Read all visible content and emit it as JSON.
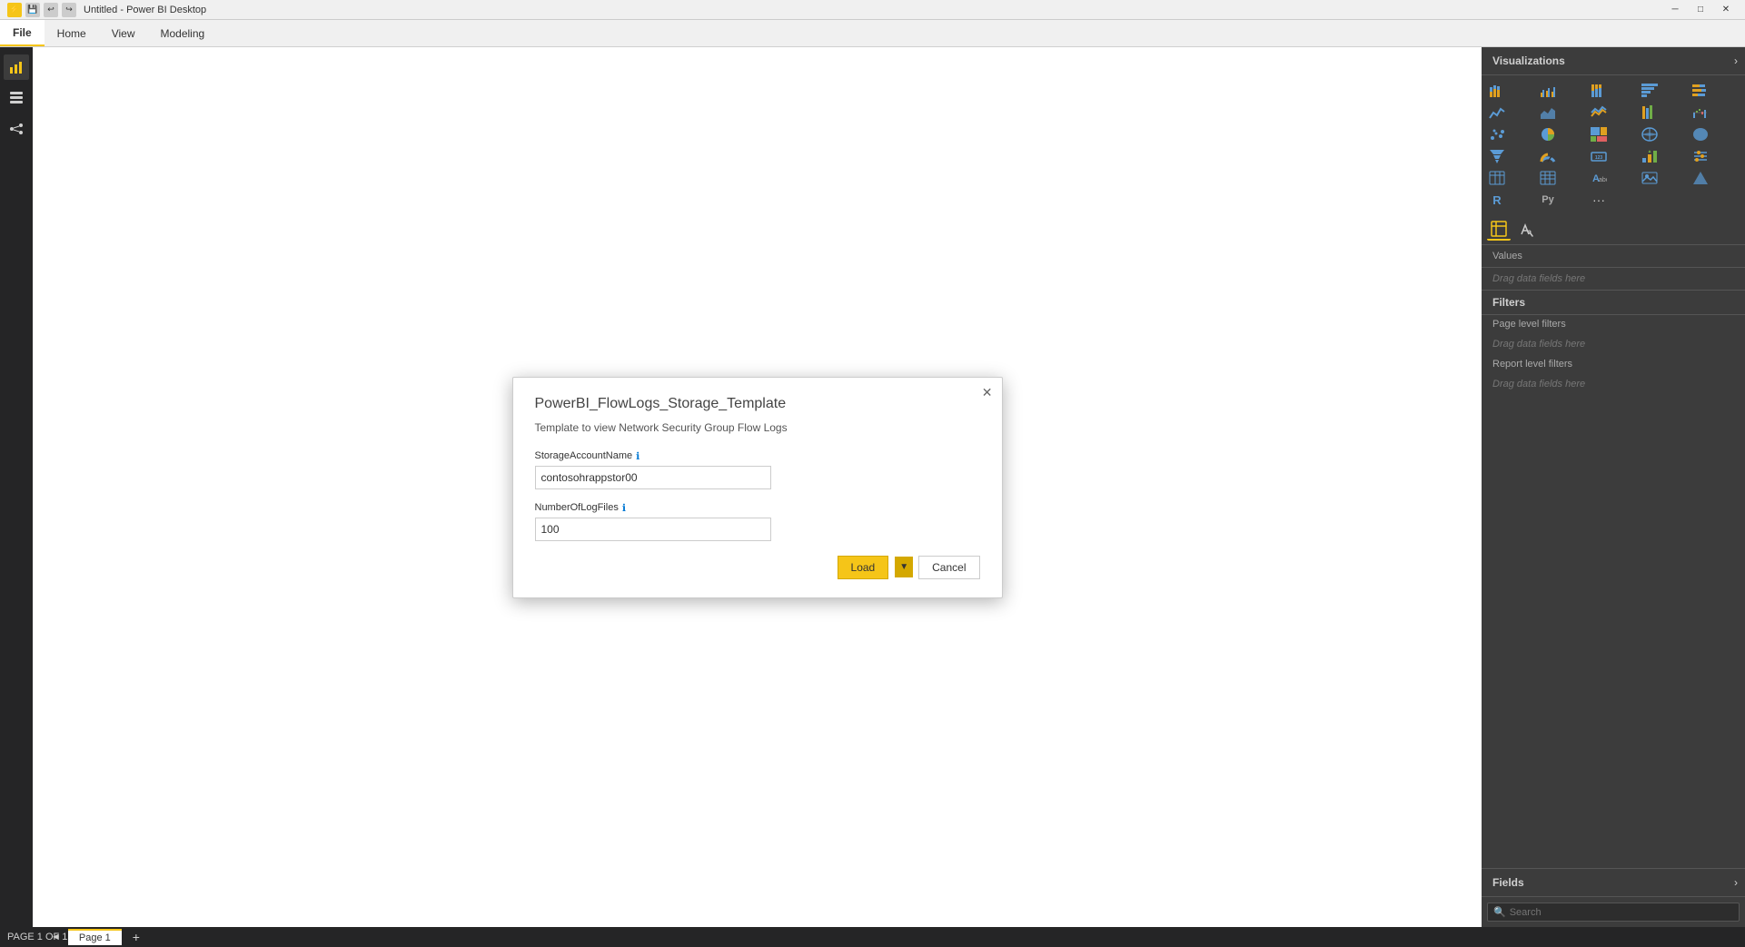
{
  "titleBar": {
    "title": "Untitled - Power BI Desktop",
    "icons": [
      "💾",
      "↩",
      "↪"
    ],
    "controls": [
      "─",
      "□",
      "✕"
    ]
  },
  "ribbon": {
    "tabs": [
      {
        "label": "File",
        "active": true
      },
      {
        "label": "Home",
        "active": false
      },
      {
        "label": "View",
        "active": false
      },
      {
        "label": "Modeling",
        "active": false
      }
    ]
  },
  "sidebar": {
    "icons": [
      "📊",
      "⊞",
      "🔗"
    ]
  },
  "visualizations": {
    "title": "Visualizations",
    "vizIcons": [
      "bar",
      "line",
      "area",
      "stacked-bar",
      "clustered-bar",
      "scatter",
      "pie",
      "treemap",
      "map",
      "filled-map",
      "table",
      "matrix",
      "card",
      "kpi",
      "slicer",
      "shape",
      "image",
      "text",
      "r",
      "py",
      "more"
    ],
    "toolbarTabs": [
      {
        "label": "⊞",
        "name": "fields-tab",
        "active": false
      },
      {
        "label": "🖌",
        "name": "format-tab",
        "active": false
      }
    ],
    "valuesLabel": "Values",
    "valuesDragHint": "Drag data fields here",
    "filtersLabel": "Filters",
    "pageLevelFilters": "Page level filters",
    "pageLevelDragHint": "Drag data fields here",
    "reportLevelFilters": "Report level filters",
    "reportLevelDragHint": "Drag data fields here"
  },
  "fields": {
    "title": "Fields",
    "search": {
      "placeholder": "Search",
      "value": ""
    }
  },
  "dialog": {
    "title": "PowerBI_FlowLogs_Storage_Template",
    "subtitle": "Template to view Network Security Group Flow Logs",
    "fields": [
      {
        "label": "StorageAccountName",
        "hasInfo": true,
        "value": "contosohrappstor00",
        "placeholder": ""
      },
      {
        "label": "NumberOfLogFiles",
        "hasInfo": true,
        "value": "100",
        "placeholder": ""
      }
    ],
    "loadButton": "Load",
    "cancelButton": "Cancel"
  },
  "statusBar": {
    "pageInfo": "PAGE 1 OF 1",
    "pageName": "Page 1"
  }
}
